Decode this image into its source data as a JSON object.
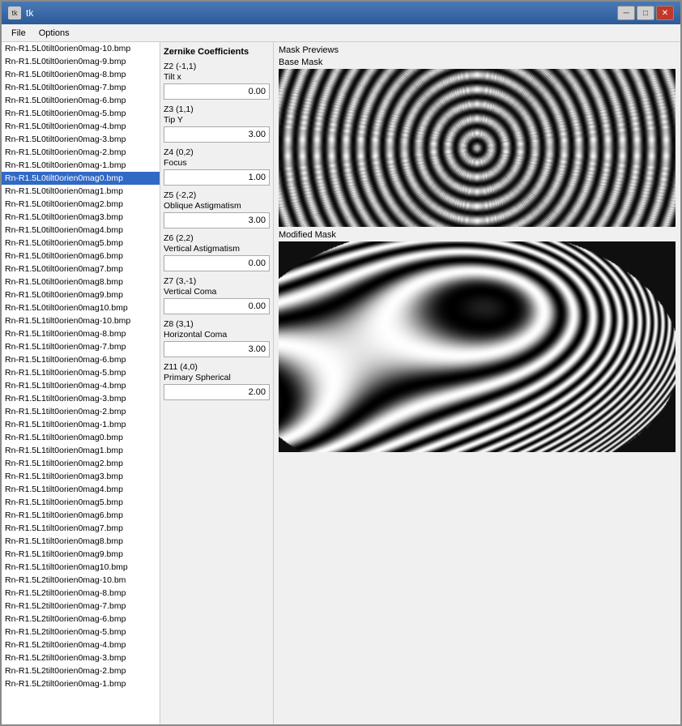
{
  "window": {
    "title": "tk",
    "icon": "tk"
  },
  "titlebar": {
    "minimize_label": "─",
    "maximize_label": "□",
    "close_label": "✕"
  },
  "menu": {
    "items": [
      {
        "label": "File"
      },
      {
        "label": "Options"
      }
    ]
  },
  "file_list": {
    "items": [
      "Rn-R1.5L0tilt0orien0mag-10.bmp",
      "Rn-R1.5L0tilt0orien0mag-9.bmp",
      "Rn-R1.5L0tilt0orien0mag-8.bmp",
      "Rn-R1.5L0tilt0orien0mag-7.bmp",
      "Rn-R1.5L0tilt0orien0mag-6.bmp",
      "Rn-R1.5L0tilt0orien0mag-5.bmp",
      "Rn-R1.5L0tilt0orien0mag-4.bmp",
      "Rn-R1.5L0tilt0orien0mag-3.bmp",
      "Rn-R1.5L0tilt0orien0mag-2.bmp",
      "Rn-R1.5L0tilt0orien0mag-1.bmp",
      "Rn-R1.5L0tilt0orien0mag0.bmp",
      "Rn-R1.5L0tilt0orien0mag1.bmp",
      "Rn-R1.5L0tilt0orien0mag2.bmp",
      "Rn-R1.5L0tilt0orien0mag3.bmp",
      "Rn-R1.5L0tilt0orien0mag4.bmp",
      "Rn-R1.5L0tilt0orien0mag5.bmp",
      "Rn-R1.5L0tilt0orien0mag6.bmp",
      "Rn-R1.5L0tilt0orien0mag7.bmp",
      "Rn-R1.5L0tilt0orien0mag8.bmp",
      "Rn-R1.5L0tilt0orien0mag9.bmp",
      "Rn-R1.5L0tilt0orien0mag10.bmp",
      "Rn-R1.5L1tilt0orien0mag-10.bmp",
      "Rn-R1.5L1tilt0orien0mag-8.bmp",
      "Rn-R1.5L1tilt0orien0mag-7.bmp",
      "Rn-R1.5L1tilt0orien0mag-6.bmp",
      "Rn-R1.5L1tilt0orien0mag-5.bmp",
      "Rn-R1.5L1tilt0orien0mag-4.bmp",
      "Rn-R1.5L1tilt0orien0mag-3.bmp",
      "Rn-R1.5L1tilt0orien0mag-2.bmp",
      "Rn-R1.5L1tilt0orien0mag-1.bmp",
      "Rn-R1.5L1tilt0orien0mag0.bmp",
      "Rn-R1.5L1tilt0orien0mag1.bmp",
      "Rn-R1.5L1tilt0orien0mag2.bmp",
      "Rn-R1.5L1tilt0orien0mag3.bmp",
      "Rn-R1.5L1tilt0orien0mag4.bmp",
      "Rn-R1.5L1tilt0orien0mag5.bmp",
      "Rn-R1.5L1tilt0orien0mag6.bmp",
      "Rn-R1.5L1tilt0orien0mag7.bmp",
      "Rn-R1.5L1tilt0orien0mag8.bmp",
      "Rn-R1.5L1tilt0orien0mag9.bmp",
      "Rn-R1.5L1tilt0orien0mag10.bmp",
      "Rn-R1.5L2tilt0orien0mag-10.bm",
      "Rn-R1.5L2tilt0orien0mag-8.bmp",
      "Rn-R1.5L2tilt0orien0mag-7.bmp",
      "Rn-R1.5L2tilt0orien0mag-6.bmp",
      "Rn-R1.5L2tilt0orien0mag-5.bmp",
      "Rn-R1.5L2tilt0orien0mag-4.bmp",
      "Rn-R1.5L2tilt0orien0mag-3.bmp",
      "Rn-R1.5L2tilt0orien0mag-2.bmp",
      "Rn-R1.5L2tilt0orien0mag-1.bmp"
    ],
    "selected_index": 10
  },
  "zernike": {
    "title": "Zernike Coefficients",
    "coefficients": [
      {
        "id": "Z2 (-1,1)",
        "name": "Tilt x",
        "value": "0.00"
      },
      {
        "id": "Z3 (1,1)",
        "name": "Tip Y",
        "value": "3.00"
      },
      {
        "id": "Z4 (0,2)",
        "name": "Focus",
        "value": "1.00"
      },
      {
        "id": "Z5 (-2,2)",
        "name": "Oblique Astigmatism",
        "value": "3.00"
      },
      {
        "id": "Z6 (2,2)",
        "name": "Vertical Astigmatism",
        "value": "0.00"
      },
      {
        "id": "Z7 (3,-1)",
        "name": "Vertical Coma",
        "value": "0.00"
      },
      {
        "id": "Z8 (3,1)",
        "name": "Horizontal Coma",
        "value": "3.00"
      },
      {
        "id": "Z11 (4,0)",
        "name": "Primary Spherical",
        "value": "2.00"
      }
    ]
  },
  "mask_previews": {
    "title": "Mask Previews",
    "base_mask_label": "Base Mask",
    "modified_mask_label": "Modified Mask"
  }
}
